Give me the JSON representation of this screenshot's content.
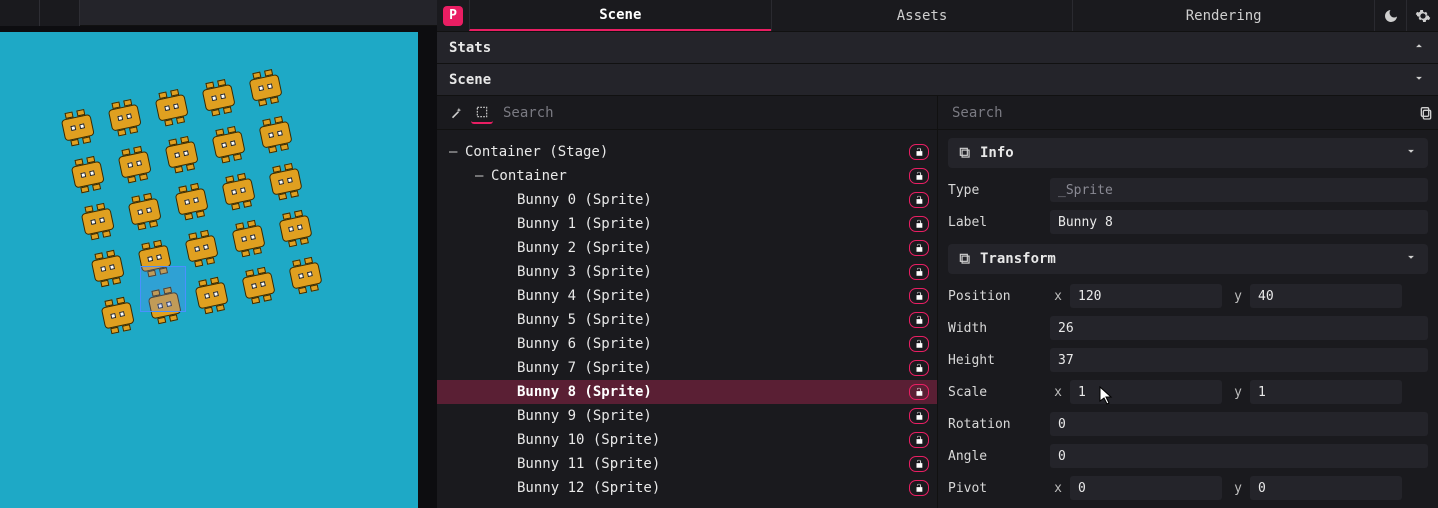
{
  "tabs": {
    "scene": "Scene",
    "assets": "Assets",
    "rendering": "Rendering"
  },
  "sections": {
    "stats": "Stats",
    "scene": "Scene"
  },
  "search_placeholder": "Search",
  "tree": [
    {
      "label": "Container (Stage)",
      "indent": 0,
      "toggle": true
    },
    {
      "label": "Container",
      "indent": 1,
      "toggle": true
    },
    {
      "label": "Bunny 0 (Sprite)",
      "indent": 2
    },
    {
      "label": "Bunny 1 (Sprite)",
      "indent": 2
    },
    {
      "label": "Bunny 2 (Sprite)",
      "indent": 2
    },
    {
      "label": "Bunny 3 (Sprite)",
      "indent": 2
    },
    {
      "label": "Bunny 4 (Sprite)",
      "indent": 2
    },
    {
      "label": "Bunny 5 (Sprite)",
      "indent": 2
    },
    {
      "label": "Bunny 6 (Sprite)",
      "indent": 2
    },
    {
      "label": "Bunny 7 (Sprite)",
      "indent": 2
    },
    {
      "label": "Bunny 8 (Sprite)",
      "indent": 2,
      "selected": true
    },
    {
      "label": "Bunny 9 (Sprite)",
      "indent": 2
    },
    {
      "label": "Bunny 10 (Sprite)",
      "indent": 2
    },
    {
      "label": "Bunny 11 (Sprite)",
      "indent": 2
    },
    {
      "label": "Bunny 12 (Sprite)",
      "indent": 2
    }
  ],
  "inspector": {
    "info_title": "Info",
    "transform_title": "Transform",
    "type_label": "Type",
    "type_value": "_Sprite",
    "label_label": "Label",
    "label_value": "Bunny 8",
    "position_label": "Position",
    "position_x": "120",
    "position_y": "40",
    "width_label": "Width",
    "width_value": "26",
    "height_label": "Height",
    "height_value": "37",
    "scale_label": "Scale",
    "scale_x": "1",
    "scale_y": "1",
    "rotation_label": "Rotation",
    "rotation_value": "0",
    "angle_label": "Angle",
    "angle_value": "0",
    "pivot_label": "Pivot",
    "pivot_x": "0",
    "pivot_y": "0",
    "axis_x": "x",
    "axis_y": "y"
  },
  "logo_letter": "P"
}
